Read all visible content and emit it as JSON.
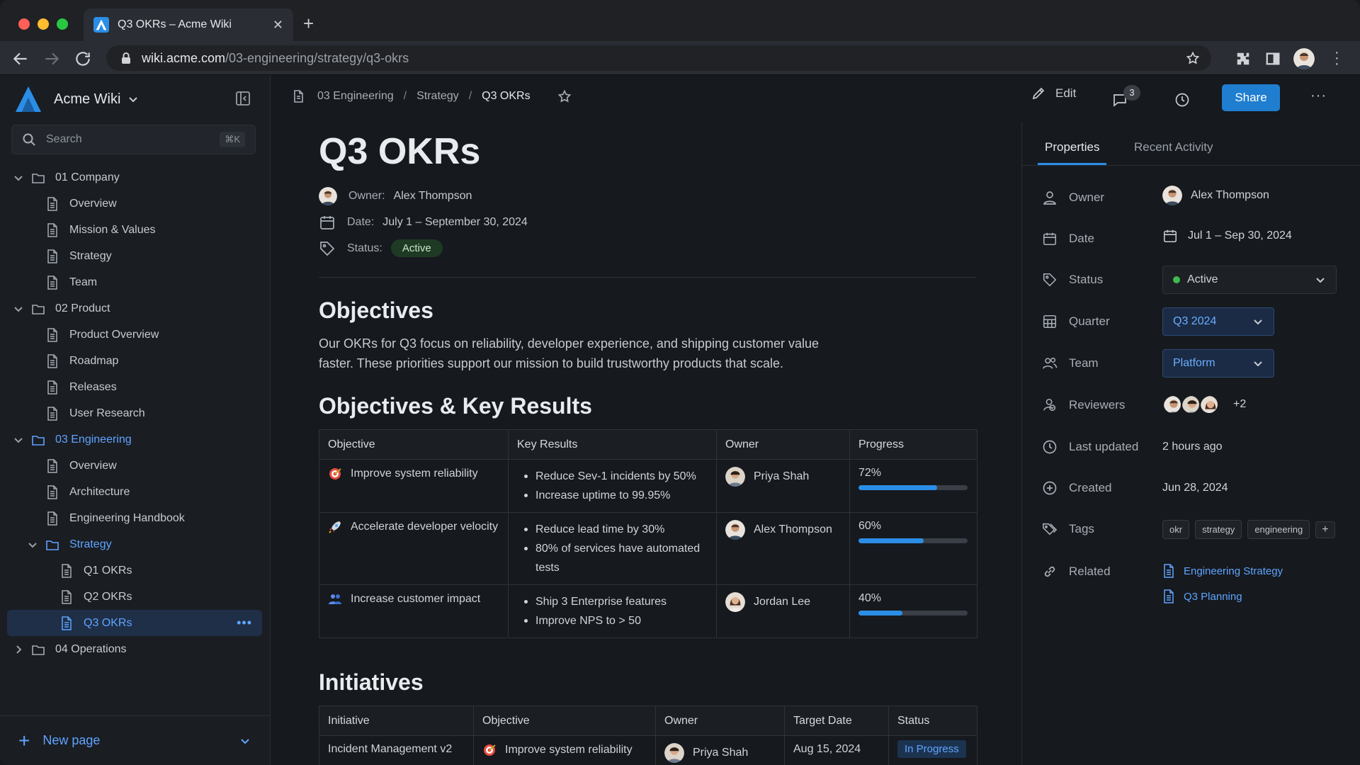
{
  "browser": {
    "tab_title": "Q3 OKRs – Acme Wiki",
    "url_host": "wiki.acme.com",
    "url_path": "/03-engineering/strategy/q3-okrs"
  },
  "sidebar": {
    "brand": "Acme Wiki",
    "search_placeholder": "Search",
    "search_shortcut": "⌘K",
    "tree": [
      {
        "label": "01 Company",
        "kind": "folder",
        "level": 0,
        "expanded": true
      },
      {
        "label": "Overview",
        "kind": "page",
        "level": 1
      },
      {
        "label": "Mission & Values",
        "kind": "page",
        "level": 1
      },
      {
        "label": "Strategy",
        "kind": "page",
        "level": 1
      },
      {
        "label": "Team",
        "kind": "page",
        "level": 1
      },
      {
        "label": "02 Product",
        "kind": "folder",
        "level": 0,
        "expanded": true
      },
      {
        "label": "Product Overview",
        "kind": "page",
        "level": 1
      },
      {
        "label": "Roadmap",
        "kind": "page",
        "level": 1
      },
      {
        "label": "Releases",
        "kind": "page",
        "level": 1
      },
      {
        "label": "User Research",
        "kind": "page",
        "level": 1
      },
      {
        "label": "03 Engineering",
        "kind": "folder",
        "level": 0,
        "expanded": true,
        "active": true
      },
      {
        "label": "Overview",
        "kind": "page",
        "level": 1
      },
      {
        "label": "Architecture",
        "kind": "page",
        "level": 1
      },
      {
        "label": "Engineering Handbook",
        "kind": "page",
        "level": 1
      },
      {
        "label": "Strategy",
        "kind": "folder",
        "level": 1,
        "expanded": true,
        "active": true
      },
      {
        "label": "Q1 OKRs",
        "kind": "page",
        "level": 2
      },
      {
        "label": "Q2 OKRs",
        "kind": "page",
        "level": 2
      },
      {
        "label": "Q3 OKRs",
        "kind": "page",
        "level": 2,
        "selected": true
      },
      {
        "label": "04 Operations",
        "kind": "folder",
        "level": 0,
        "expanded": false
      }
    ],
    "new_page": "New page"
  },
  "header": {
    "breadcrumb": [
      "03 Engineering",
      "Strategy",
      "Q3 OKRs"
    ],
    "edit_label": "Edit",
    "comment_count": "3",
    "share_label": "Share"
  },
  "page": {
    "title": "Q3 OKRs",
    "owner_label": "Owner:",
    "owner": "Alex Thompson",
    "date_label": "Date:",
    "date": "July 1 – September 30, 2024",
    "status_label": "Status:",
    "status": "Active",
    "objectives_heading": "Objectives",
    "objectives_text": "Our OKRs for Q3 focus on reliability, developer experience, and shipping customer value faster. These priorities support our mission to build trustworthy products that scale.",
    "okr_heading": "Objectives & Key Results",
    "okr_columns": [
      "Objective",
      "Key Results",
      "Owner",
      "Progress"
    ],
    "okr_rows": [
      {
        "icon": "target-icon",
        "objective": "Improve system reliability",
        "key_results": [
          "Reduce Sev-1 incidents by 50%",
          "Increase uptime to 99.95%"
        ],
        "owner": "Priya Shah",
        "progress_label": "72%",
        "progress": 0.72
      },
      {
        "icon": "rocket-icon",
        "objective": "Accelerate developer velocity",
        "key_results": [
          "Reduce lead time by 30%",
          "80% of services have automated tests"
        ],
        "owner": "Alex Thompson",
        "progress_label": "60%",
        "progress": 0.6
      },
      {
        "icon": "people-icon",
        "objective": "Increase customer impact",
        "key_results": [
          "Ship 3 Enterprise features",
          "Improve NPS to > 50"
        ],
        "owner": "Jordan Lee",
        "progress_label": "40%",
        "progress": 0.4
      }
    ],
    "initiatives_heading": "Initiatives",
    "initiative_columns": [
      "Initiative",
      "Objective",
      "Owner",
      "Target Date",
      "Status"
    ],
    "initiative_rows": [
      {
        "initiative": "Incident Management v2",
        "objective": "Improve system reliability",
        "owner": "Priya Shah",
        "target_date": "Aug 15, 2024",
        "status": "In Progress"
      }
    ]
  },
  "panel": {
    "tabs": [
      "Properties",
      "Recent Activity"
    ],
    "owner_label": "Owner",
    "owner": "Alex Thompson",
    "date_label": "Date",
    "date": "Jul 1 – Sep 30, 2024",
    "status_label": "Status",
    "status": "Active",
    "quarter_label": "Quarter",
    "quarter": "Q3 2024",
    "team_label": "Team",
    "team": "Platform",
    "reviewers_label": "Reviewers",
    "reviewers_more": "+2",
    "updated_label": "Last updated",
    "updated": "2 hours ago",
    "created_label": "Created",
    "created": "Jun 28, 2024",
    "tags_label": "Tags",
    "tags": [
      "okr",
      "strategy",
      "engineering"
    ],
    "tags_add": "+",
    "related_label": "Related",
    "related": [
      "Engineering Strategy",
      "Q3 Planning"
    ]
  },
  "colors": {
    "accent": "#1f7ed0",
    "link": "#5fa4ff",
    "active_green": "#3fb950",
    "progress": "#2b8ee6"
  }
}
